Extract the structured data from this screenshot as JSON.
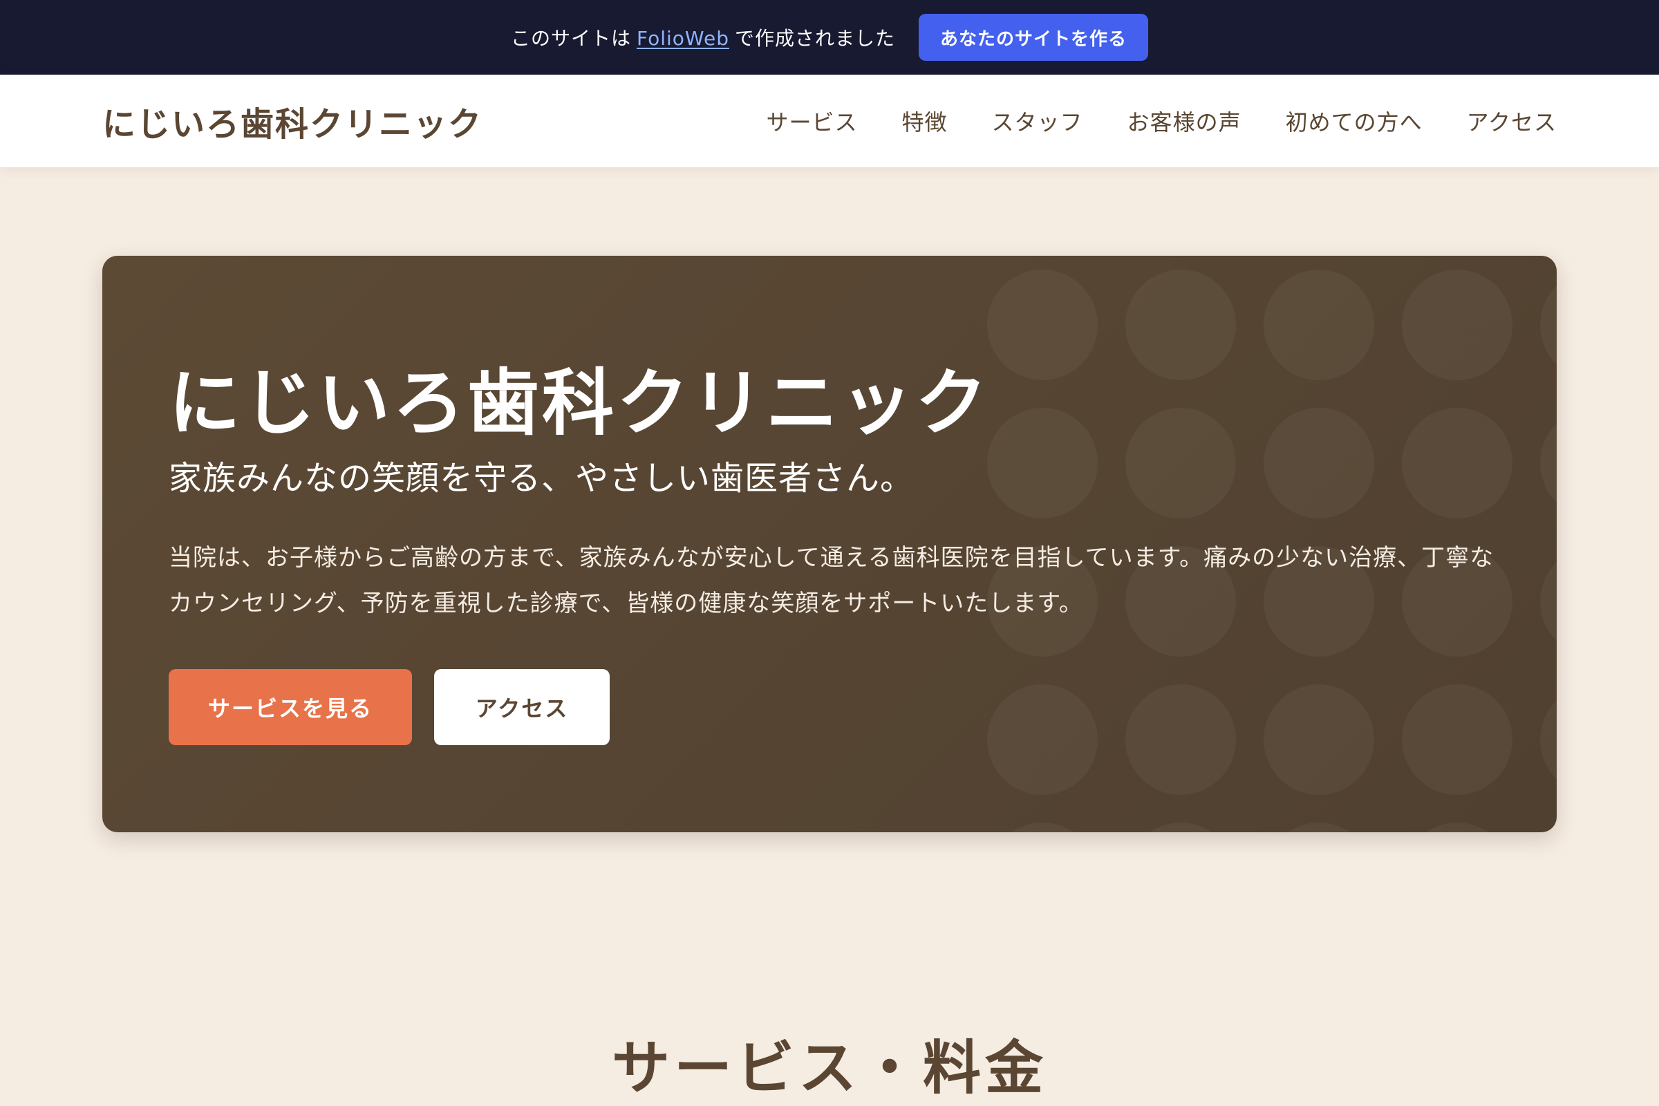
{
  "promo": {
    "text_before": "このサイトは",
    "link": "FolioWeb",
    "text_after": "で作成されました",
    "button": "あなたのサイトを作る"
  },
  "header": {
    "logo": "にじいろ歯科クリニック",
    "nav": [
      "サービス",
      "特徴",
      "スタッフ",
      "お客様の声",
      "初めての方へ",
      "アクセス"
    ]
  },
  "hero": {
    "title": "にじいろ歯科クリニック",
    "subtitle": "家族みんなの笑顔を守る、やさしい歯医者さん。",
    "description": "当院は、お子様からご高齢の方まで、家族みんなが安心して通える歯科医院を目指しています。痛みの少ない治療、丁寧なカウンセリング、予防を重視した診療で、皆様の健康な笑顔をサポートいたします。",
    "primary_button": "サービスを見る",
    "secondary_button": "アクセス"
  },
  "sections": {
    "services_title": "サービス・料金"
  },
  "colors": {
    "promo_bg": "#181a31",
    "promo_button": "#4460ee",
    "page_bg": "#f5ece2",
    "brand_brown": "#5a4632",
    "accent_orange": "#e8724a"
  }
}
